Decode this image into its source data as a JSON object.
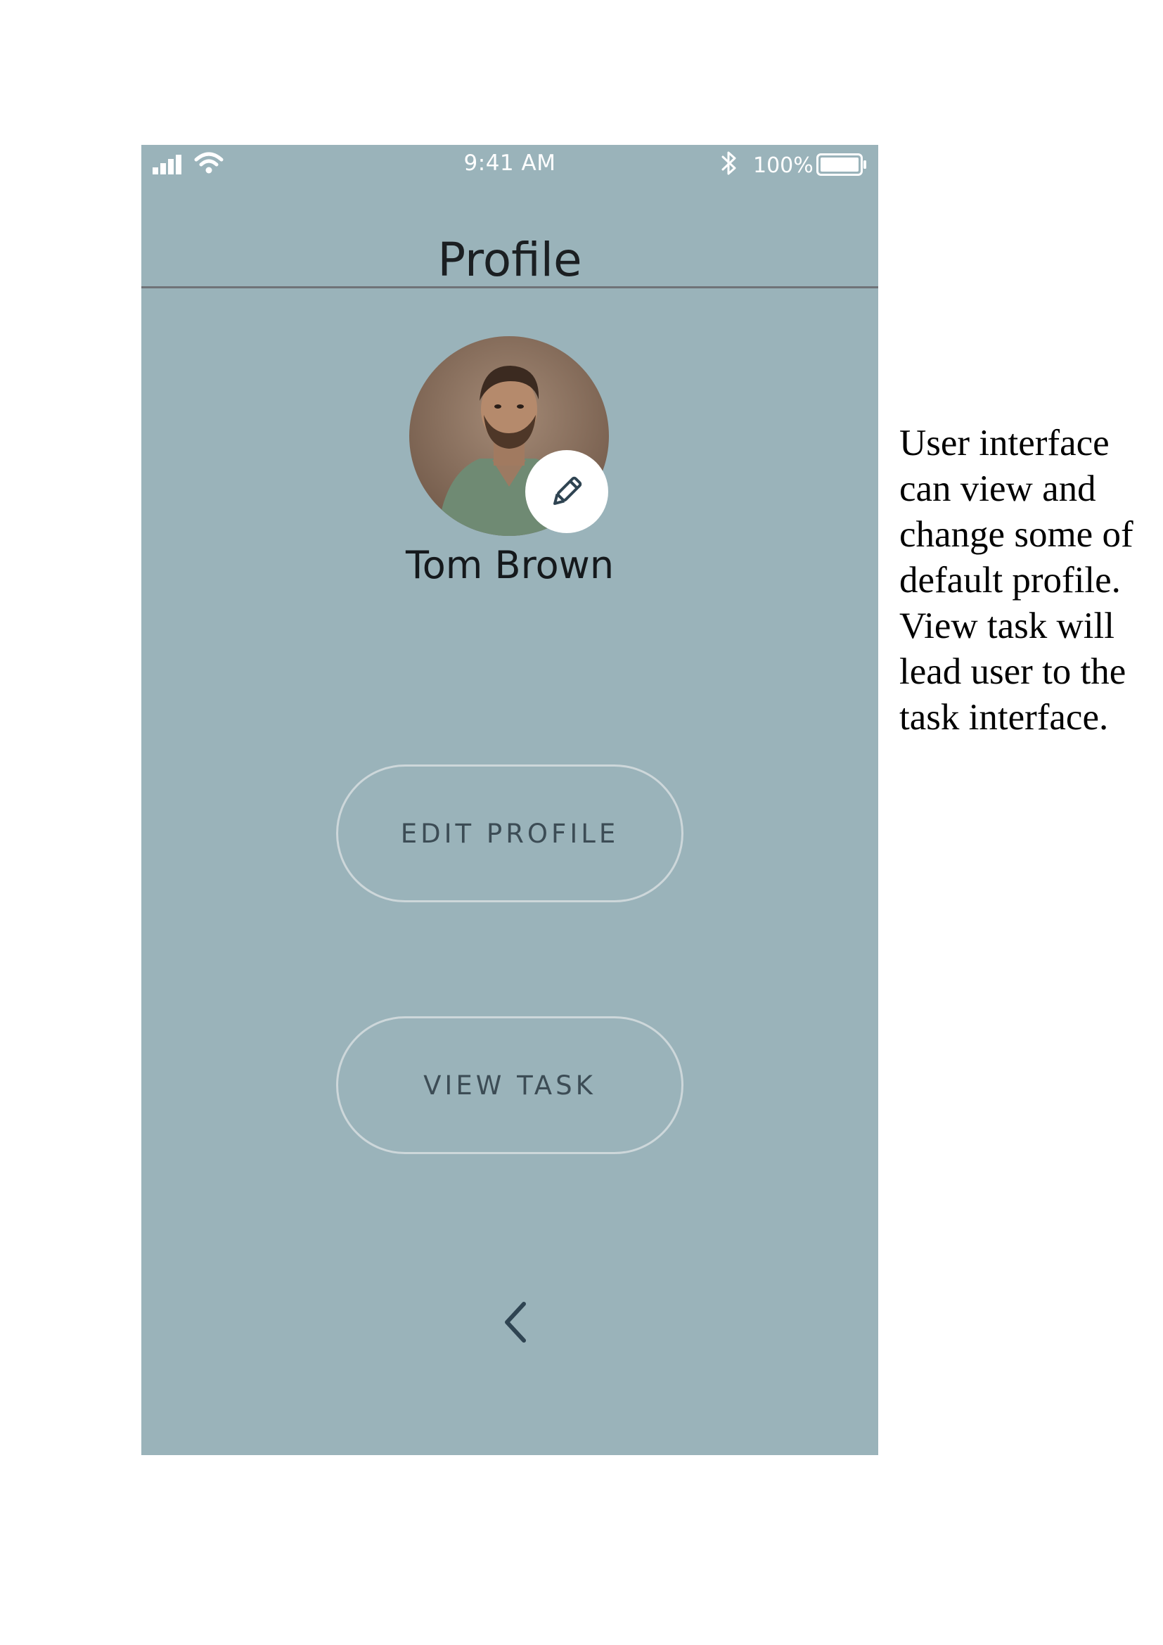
{
  "status_bar": {
    "time": "9:41 AM",
    "battery_percent": "100%",
    "icons": [
      "signal-icon",
      "wifi-icon",
      "bluetooth-icon",
      "battery-icon"
    ]
  },
  "header": {
    "title": "Profile"
  },
  "profile": {
    "name": "Tom Brown",
    "avatar_icon": "avatar-photo",
    "edit_icon": "pencil-icon"
  },
  "buttons": {
    "edit_profile": "EDIT PROFILE",
    "view_task": "VIEW TASK"
  },
  "navigation": {
    "back_icon": "chevron-left-icon"
  },
  "annotation": {
    "text": "User interface\ncan view and\nchange some of\ndefault profile.\nView task will\nlead user to the\ntask interface."
  },
  "colors": {
    "screen_background": "#9ab3ba",
    "divider": "#6f7378",
    "button_border": "#cdd7da",
    "button_text": "#3c4c55",
    "icon_dark": "#2f4452"
  }
}
